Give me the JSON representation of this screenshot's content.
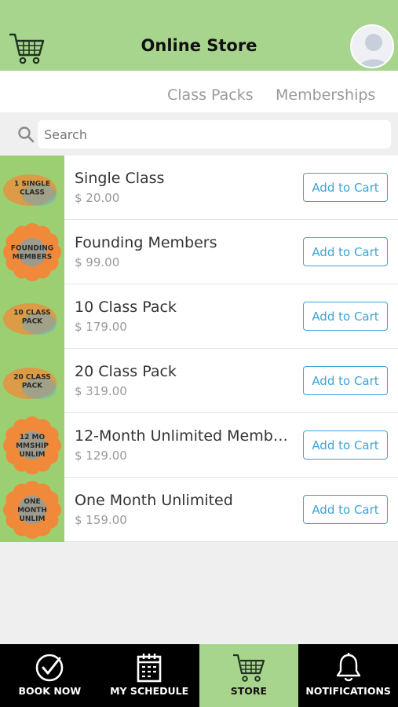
{
  "header": {
    "title": "Online Store",
    "cart_icon": "shopping-cart-icon",
    "avatar_icon": "user-avatar"
  },
  "tabs": [
    {
      "label": "Class Packs"
    },
    {
      "label": "Memberships"
    }
  ],
  "search": {
    "placeholder": "Search",
    "value": ""
  },
  "products": [
    {
      "name": "Single Class",
      "price": "$ 20.00",
      "button": "Add to Cart",
      "thumb_text": [
        "1 SINGLE",
        "CLASS"
      ],
      "thumb_style": "blob"
    },
    {
      "name": "Founding Members",
      "price": "$ 99.00",
      "button": "Add to Cart",
      "thumb_text": [
        "FOUNDING",
        "MEMBERS"
      ],
      "thumb_style": "flower"
    },
    {
      "name": "10 Class Pack",
      "price": "$ 179.00",
      "button": "Add to Cart",
      "thumb_text": [
        "10 CLASS",
        "PACK"
      ],
      "thumb_style": "blob"
    },
    {
      "name": "20 Class Pack",
      "price": "$ 319.00",
      "button": "Add to Cart",
      "thumb_text": [
        "20 CLASS",
        "PACK"
      ],
      "thumb_style": "blob"
    },
    {
      "name": "12-Month Unlimited Membe...",
      "price": "$ 129.00",
      "button": "Add to Cart",
      "thumb_text": [
        "12 MO",
        "MMSHIP",
        "UNLIM"
      ],
      "thumb_style": "flower"
    },
    {
      "name": "One Month Unlimited",
      "price": "$ 159.00",
      "button": "Add to Cart",
      "thumb_text": [
        "ONE",
        "MONTH",
        "UNLIM"
      ],
      "thumb_style": "flower"
    }
  ],
  "tabbar": [
    {
      "label": "BOOK NOW",
      "icon": "check-circle-icon",
      "active": false
    },
    {
      "label": "MY SCHEDULE",
      "icon": "calendar-icon",
      "active": false
    },
    {
      "label": "STORE",
      "icon": "cart-icon",
      "active": true
    },
    {
      "label": "NOTIFICATIONS",
      "icon": "bell-icon",
      "active": false
    }
  ],
  "colors": {
    "header_bg": "#a8d58e",
    "accent_blue": "#3da3d9",
    "tabbar_bg": "#000000",
    "thumb_green": "#9ccf72",
    "thumb_orange": "#f08a3a"
  }
}
